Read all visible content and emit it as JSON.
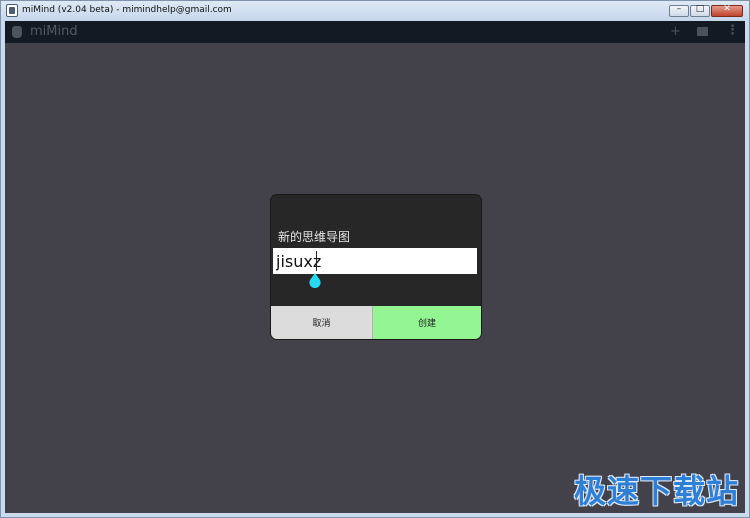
{
  "window": {
    "title": "miMind (v2.04 beta) - mimindhelp@gmail.com",
    "controls": {
      "minimize": "–",
      "maximize": "□",
      "close": "✕"
    }
  },
  "appbar": {
    "title": "miMind",
    "icons": [
      "logo-icon",
      "add-icon",
      "folder-icon",
      "more-vert-icon"
    ],
    "add_glyph": "+",
    "more_glyph": "⋮"
  },
  "dialog": {
    "title": "新的思维导图",
    "input_value": "jisuxz",
    "cancel_label": "取消",
    "create_label": "创建",
    "colors": {
      "create": "#93f492",
      "cancel": "#dcdcdc",
      "handle": "#28d8f0"
    }
  },
  "watermark": {
    "text": "极速下载站",
    "color": "#2f7fd6"
  }
}
